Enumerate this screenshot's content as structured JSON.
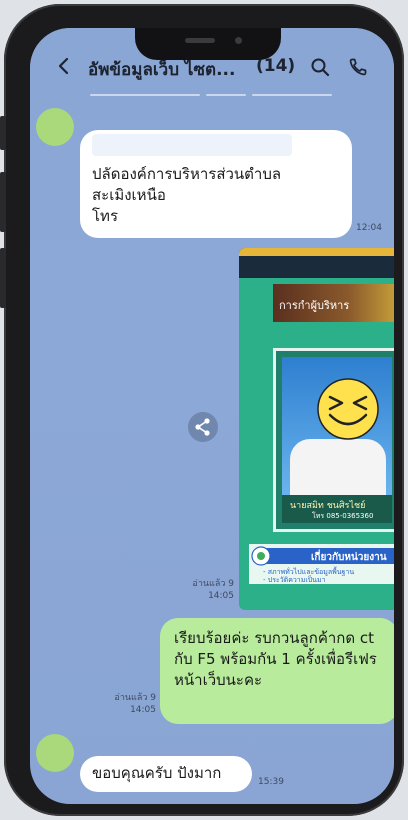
{
  "header": {
    "title": "อัพข้อมูลเว็บ ไซต...",
    "count": "(14)",
    "back_icon": "chevron-left-icon",
    "search_icon": "search-icon",
    "call_icon": "phone-icon"
  },
  "messages": [
    {
      "kind": "incoming",
      "text_lines": [
        "ปลัดองค์การบริหารส่วนตำบล",
        "สะเมิงเหนือ",
        "โทร"
      ],
      "time": "12:04"
    },
    {
      "kind": "outgoing-image",
      "read_label": "อ่านแล้ว 9",
      "time": "14:05",
      "image_text": {
        "tag": "การกำผู้บริหาร",
        "name": "นายสมิท ชนศิรไชย์",
        "tel": "โทร 085-0365360",
        "section": "เกี่ยวกับหน่วยงาน",
        "line1": "- สภาพทั่วไปและข้อมูลพื้นฐาน",
        "line2": "- ประวัติความเป็นมา"
      }
    },
    {
      "kind": "outgoing",
      "text_lines": [
        "เรียบร้อยค่ะ รบกวนลูกค้ากด ct",
        "กับ F5 พร้อมกัน 1 ครั้งเพื่อรีเฟร",
        "หน้าเว็บนะคะ"
      ],
      "read_label": "อ่านแล้ว 9",
      "time": "14:05"
    },
    {
      "kind": "incoming",
      "text_lines": [
        "ขอบคุณครับ ปังมาก"
      ],
      "time": "15:39"
    }
  ],
  "share_icon": "share-icon",
  "colors": {
    "chat_background": "#8aa6d4",
    "incoming_bubble": "#ffffff",
    "outgoing_bubble": "#b8ec9c",
    "avatar": "#a9d97a"
  }
}
